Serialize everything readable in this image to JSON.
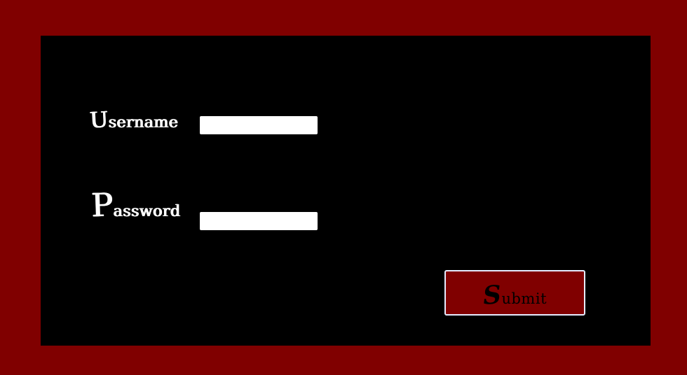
{
  "colors": {
    "page_background": "#800000",
    "panel_background": "#000000",
    "label_text": "#ffffff",
    "input_background": "#ffffff",
    "button_background": "#800000",
    "button_border": "#e6ecff",
    "button_text": "#000000"
  },
  "form": {
    "username": {
      "label_initial": "U",
      "label_rest": "sername",
      "value": ""
    },
    "password": {
      "label_initial": "P",
      "label_rest": "assword",
      "value": ""
    },
    "submit": {
      "label_initial": "S",
      "label_rest": "ubmit"
    }
  }
}
